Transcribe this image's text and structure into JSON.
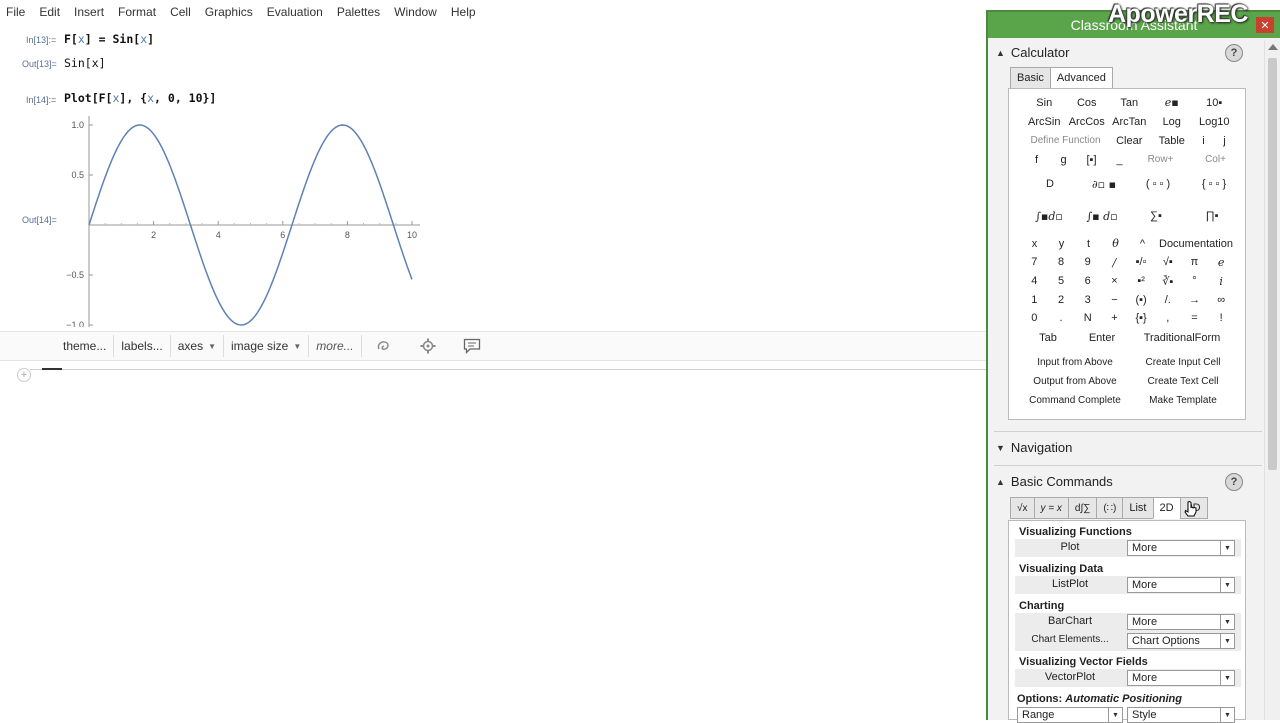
{
  "menubar": [
    "File",
    "Edit",
    "Insert",
    "Format",
    "Cell",
    "Graphics",
    "Evaluation",
    "Palettes",
    "Window",
    "Help"
  ],
  "notebook": {
    "in13_label": "In[13]:=",
    "in13_code_a": "F[",
    "in13_code_var": "x",
    "in13_code_b": "] = Sin[",
    "in13_code_c": "]",
    "out13_label": "Out[13]=",
    "out13_value": "Sin[x]",
    "in14_label": "In[14]:=",
    "in14_code_a": "Plot[F[",
    "in14_code_b": "], {",
    "in14_code_c": ", 0, 10}]",
    "out14_label": "Out[14]="
  },
  "chart_data": {
    "type": "line",
    "title": "",
    "xlabel": "",
    "ylabel": "",
    "function": "Sin[x]",
    "xlim": [
      0,
      10
    ],
    "ylim": [
      -1.0,
      1.0
    ],
    "x_ticks": [
      "2",
      "4",
      "6",
      "8",
      "10"
    ],
    "y_ticks": [
      "1.0",
      "0.5",
      "-0.5",
      "-1.0"
    ],
    "series": [
      {
        "color": "#5e81b5",
        "x": [
          0,
          0.5,
          1,
          1.5708,
          2,
          2.5,
          3,
          3.5,
          4,
          4.5,
          4.7124,
          5,
          5.5,
          6,
          6.5,
          7,
          7.5,
          7.854,
          8,
          8.5,
          9,
          9.5,
          10
        ],
        "y": [
          0,
          0.479,
          0.841,
          1,
          0.909,
          0.598,
          0.141,
          -0.351,
          -0.757,
          -0.978,
          -1,
          -0.959,
          -0.706,
          -0.279,
          0.215,
          0.657,
          0.938,
          1,
          0.989,
          0.798,
          0.412,
          -0.075,
          -0.544
        ]
      }
    ],
    "grid": false
  },
  "plot_toolbar": {
    "theme": "theme...",
    "labels": "labels...",
    "axes": "axes",
    "image_size": "image size",
    "more": "more...",
    "caret": "▼"
  },
  "new_cell_plus": "+",
  "palette": {
    "title": "Classroom Assistant",
    "close": "✕",
    "help": "?",
    "calculator": {
      "header": "Calculator",
      "tabs": [
        "Basic",
        "Advanced"
      ],
      "row1": [
        "Sin",
        "Cos",
        "Tan",
        "e▪",
        "10▪"
      ],
      "row2": [
        "ArcSin",
        "ArcCos",
        "ArcTan",
        "Log",
        "Log10"
      ],
      "row3_define": "Define Function",
      "row3": [
        "Clear",
        "Table",
        "i",
        "j"
      ],
      "row4": [
        "f",
        "g",
        "[▪]",
        "_",
        "Row+",
        "Col+"
      ],
      "row5": [
        "D",
        "∂▫ ▪",
        "( ▫ ▫ )",
        "{ ▫ ▫ }"
      ],
      "row6": [
        "∫▪d▫",
        "∫▪ d▫",
        "∑▪",
        "∏▪"
      ],
      "row7": [
        "x",
        "y",
        "t",
        "θ",
        "^",
        "Documentation"
      ],
      "row8": [
        "7",
        "8",
        "9",
        "/",
        "▪/▫",
        "√▪",
        "π",
        "e"
      ],
      "row9": [
        "4",
        "5",
        "6",
        "×",
        "▪²",
        "∛▪",
        "°",
        "i"
      ],
      "row10": [
        "1",
        "2",
        "3",
        "−",
        "(▪)",
        "/.",
        "→",
        "∞"
      ],
      "row11": [
        "0",
        ".",
        "N",
        "+",
        "{▪}",
        ",",
        "=",
        "!"
      ],
      "row12": [
        "Tab",
        "Enter",
        "TraditionalForm"
      ],
      "cmds": [
        "Input from Above",
        "Create Input Cell",
        "Output from Above",
        "Create Text Cell",
        "Command Complete",
        "Make Template"
      ]
    },
    "navigation": {
      "header": "Navigation"
    },
    "basic_commands": {
      "header": "Basic Commands",
      "tabs": [
        "√x",
        "y = x",
        "d∫∑",
        "(∷)",
        "List",
        "2D",
        "3D"
      ],
      "vis_functions": "Visualizing Functions",
      "plot": "Plot",
      "more": "More",
      "vis_data": "Visualizing Data",
      "listplot": "ListPlot",
      "charting": "Charting",
      "barchart": "BarChart",
      "chart_elements": "Chart Elements...",
      "chart_options": "Chart Options",
      "vis_vector": "Visualizing Vector Fields",
      "vectorplot": "VectorPlot",
      "options_a": "Options: ",
      "options_b": "Automatic Positioning",
      "range": "Range",
      "style": "Style"
    }
  },
  "watermark": "ApowerREC"
}
